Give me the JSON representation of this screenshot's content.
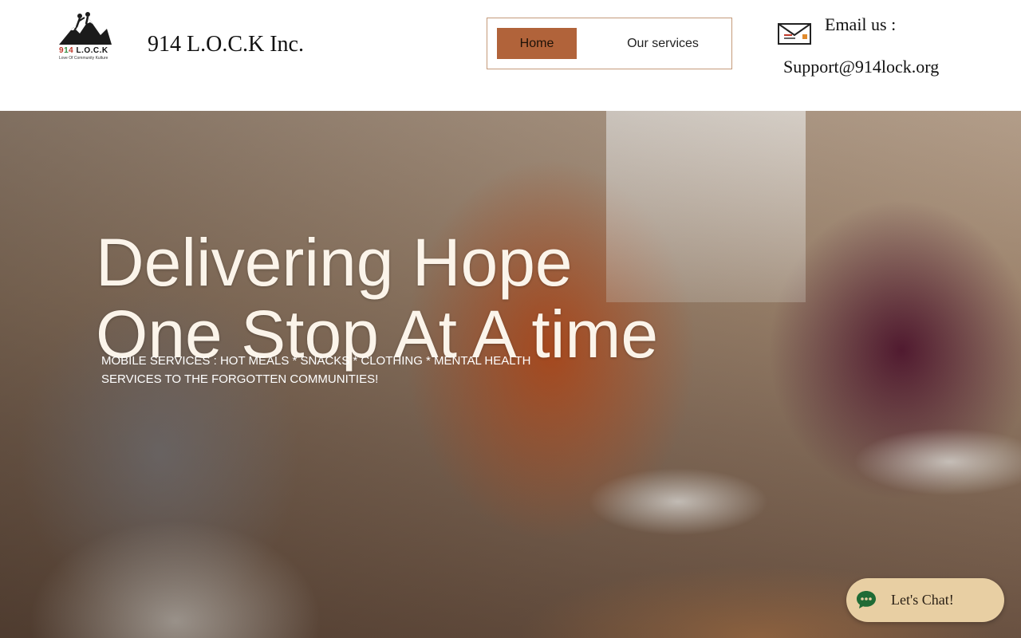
{
  "header": {
    "logo": {
      "icon": "mountain-climbers-logo",
      "wordmark": "914 L.O.C.K",
      "tagline": "Love Of Community Kulture"
    },
    "site_title": "914 L.O.C.K Inc.",
    "nav": [
      {
        "label": "Home",
        "active": true
      },
      {
        "label": "Our services",
        "active": false
      }
    ],
    "contact": {
      "icon": "mail-icon",
      "label": "Email us :",
      "address": "Support@914lock.org"
    }
  },
  "hero": {
    "headline_line1": "Delivering Hope",
    "headline_line2": "One Stop At A time",
    "subtext": "MOBILE SERVICES : HOT MEALS * SNACKS * CLOTHING * MENTAL HEALTH SERVICES TO THE FORGOTTEN COMMUNITIES!",
    "background": "family-eating-pizza-photo"
  },
  "chat": {
    "label": "Let's Chat!",
    "icon": "chat-bubble-icon"
  },
  "colors": {
    "nav_active_bg": "#b1633a",
    "nav_border": "#c49a7a",
    "chat_bg": "#e8cfa3",
    "chat_icon": "#1f6b35",
    "headline": "#fbf4ea"
  }
}
